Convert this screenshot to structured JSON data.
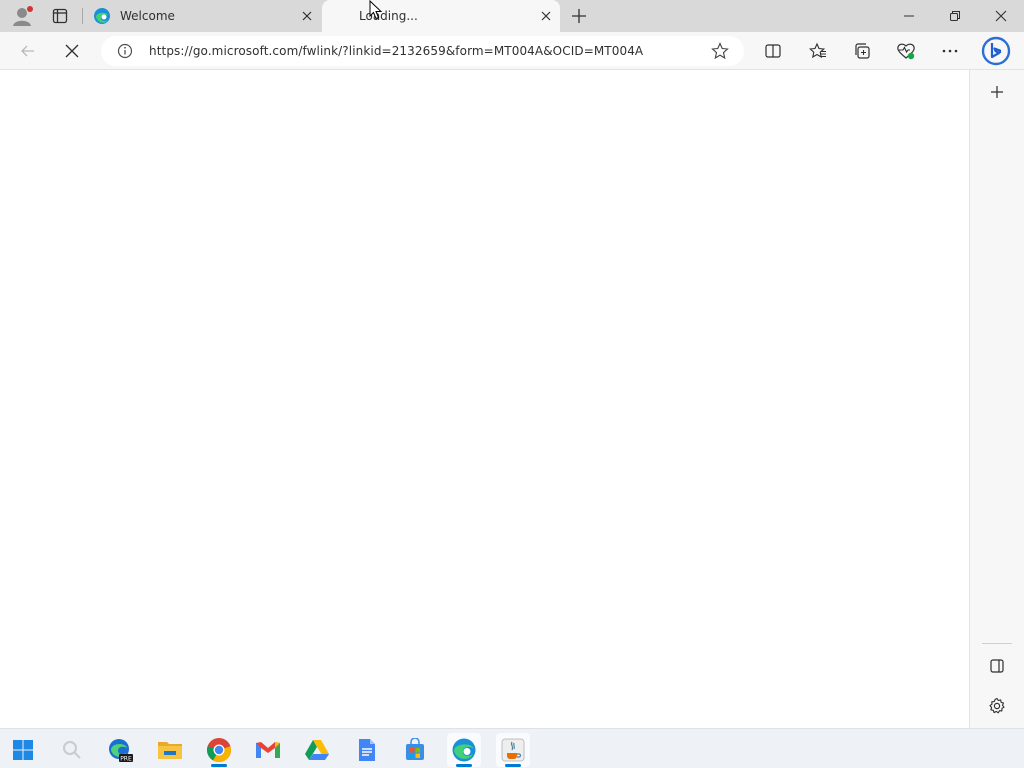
{
  "tabs": [
    {
      "title": "Welcome",
      "icon": "edge-icon",
      "active": false
    },
    {
      "title": "Loading...",
      "icon": "loading-icon",
      "active": true
    }
  ],
  "address_bar": {
    "url": "https://go.microsoft.com/fwlink/?linkid=2132659&form=MT004A&OCID=MT004A"
  },
  "colors": {
    "accent": "#0078d4",
    "tabstrip_bg": "#d9d9d9",
    "toolbar_bg": "#f7f7f7",
    "taskbar_bg": "#eef1f6"
  },
  "taskbar": {
    "items": [
      {
        "name": "start",
        "icon": "windows-logo-icon"
      },
      {
        "name": "search",
        "icon": "search-icon"
      },
      {
        "name": "edge-preview",
        "icon": "edge-pre-icon"
      },
      {
        "name": "file-explorer",
        "icon": "folder-icon"
      },
      {
        "name": "chrome",
        "icon": "chrome-icon"
      },
      {
        "name": "gmail",
        "icon": "gmail-icon"
      },
      {
        "name": "google-drive",
        "icon": "drive-icon"
      },
      {
        "name": "google-docs",
        "icon": "docs-icon"
      },
      {
        "name": "microsoft-store",
        "icon": "store-icon"
      },
      {
        "name": "edge",
        "icon": "edge-icon"
      },
      {
        "name": "java-app",
        "icon": "java-icon"
      }
    ]
  }
}
